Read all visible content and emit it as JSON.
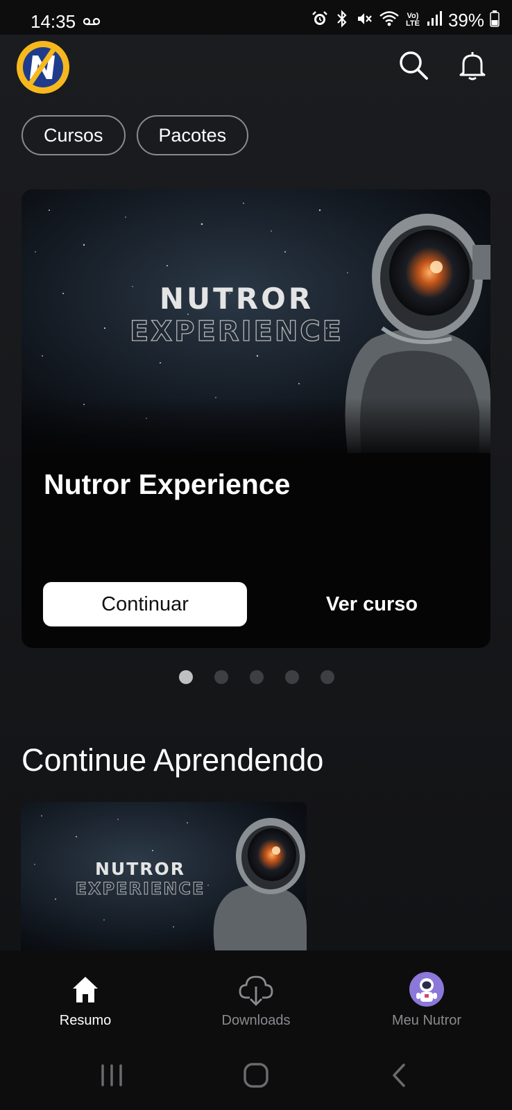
{
  "status_bar": {
    "time": "14:35",
    "battery": "39%",
    "icons": [
      "voicemail-icon",
      "alarm-icon",
      "bluetooth-icon",
      "mute-icon",
      "wifi-icon",
      "volte-icon",
      "signal-icon",
      "battery-icon"
    ],
    "volte_label": "Vo) LTE"
  },
  "header": {
    "logo": "nutror-logo",
    "logo_letter": "N",
    "search_icon": "search-icon",
    "notification_icon": "bell-icon"
  },
  "chips": [
    {
      "label": "Cursos"
    },
    {
      "label": "Pacotes"
    }
  ],
  "hero": {
    "image_title_top": "NUTROR",
    "image_title_bottom": "EXPERIENCE",
    "title": "Nutror Experience",
    "primary_button": "Continuar",
    "secondary_button": "Ver curso",
    "carousel_total": 5,
    "carousel_active": 1
  },
  "section": {
    "title": "Continue Aprendendo",
    "card": {
      "image_title_top": "NUTROR",
      "image_title_bottom": "EXPERIENCE"
    }
  },
  "bottom_nav": {
    "items": [
      {
        "label": "Resumo",
        "icon": "home-icon",
        "active": true
      },
      {
        "label": "Downloads",
        "icon": "cloud-download-icon",
        "active": false
      },
      {
        "label": "Meu Nutror",
        "icon": "avatar-icon",
        "active": false
      }
    ]
  },
  "colors": {
    "background": "#18191c",
    "card": "#050506",
    "logo_yellow": "#f6b81c",
    "logo_blue": "#1f3c8c",
    "avatar_purple": "#8b78d8",
    "inactive": "#8a8b8e"
  }
}
